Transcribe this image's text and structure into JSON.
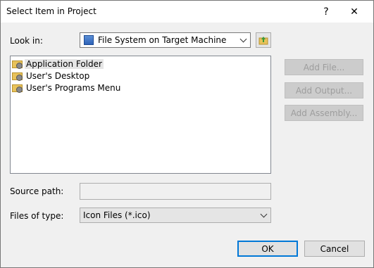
{
  "window": {
    "title": "Select Item in Project",
    "help_label": "?",
    "close_label": "✕"
  },
  "look_in": {
    "label": "Look in:",
    "value": "File System on Target Machine",
    "icon": "drive-icon"
  },
  "items": [
    {
      "label": "Application Folder",
      "selected": true
    },
    {
      "label": "User's Desktop",
      "selected": false
    },
    {
      "label": "User's Programs Menu",
      "selected": false
    }
  ],
  "side_buttons": {
    "add_file": "Add File...",
    "add_output": "Add Output...",
    "add_assembly": "Add Assembly..."
  },
  "source_path": {
    "label": "Source path:",
    "value": ""
  },
  "files_of_type": {
    "label": "Files of type:",
    "value": "Icon Files (*.ico)"
  },
  "footer": {
    "ok": "OK",
    "cancel": "Cancel"
  },
  "colors": {
    "accent": "#0078d7",
    "folder": "#e8c25a"
  }
}
